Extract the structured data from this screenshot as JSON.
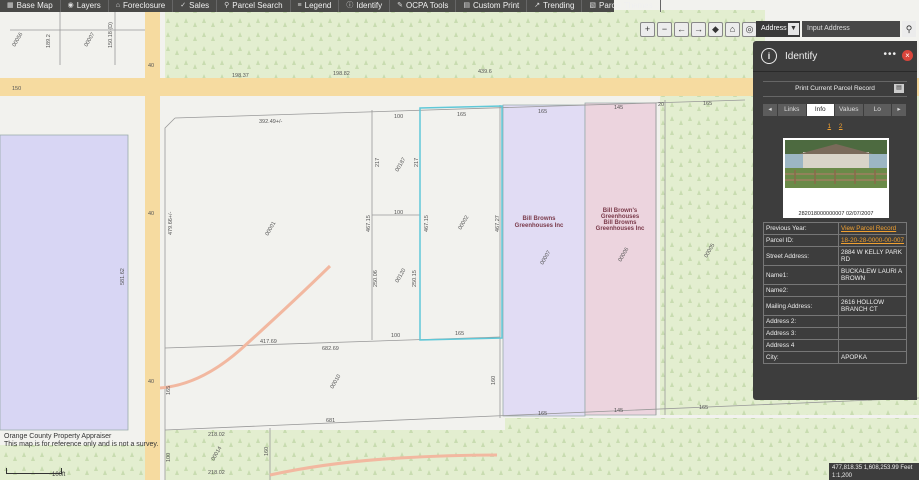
{
  "toolbar": {
    "items": [
      {
        "label": "Base Map",
        "icon": "map-icon"
      },
      {
        "label": "Layers",
        "icon": "eye-icon"
      },
      {
        "label": "Foreclosure",
        "icon": "home-icon"
      },
      {
        "label": "Sales",
        "icon": "check-icon"
      },
      {
        "label": "Parcel Search",
        "icon": "search-icon"
      },
      {
        "label": "Legend",
        "icon": "list-icon"
      },
      {
        "label": "Identify",
        "icon": "info-icon"
      },
      {
        "label": "OCPA Tools",
        "icon": "wrench-icon"
      },
      {
        "label": "Custom Print",
        "icon": "print-icon"
      },
      {
        "label": "Trending",
        "icon": "trend-icon"
      },
      {
        "label": "Parcel Themes",
        "icon": "theme-icon"
      }
    ]
  },
  "search": {
    "type_label": "Address",
    "placeholder": "Input Address"
  },
  "map": {
    "labels": {
      "parcel_00056": "00056",
      "d189_2": "189.2",
      "parcel_00007": "00007",
      "d150_18": "150.18 (D)",
      "d150": "150",
      "d40": "40",
      "d198_37": "198.37",
      "d198_82": "198.82",
      "d439_6": "439.6",
      "d392_49": "392.49+/-",
      "d100a": "100",
      "d165a": "165",
      "d165b": "165",
      "d145a": "145",
      "d20": "20",
      "d165c": "165",
      "d217a": "217",
      "d217b": "217",
      "parcel_00187": "00187",
      "d100b": "100",
      "parcel_00001": "00001",
      "d467_15a": "467.15",
      "d467_15b": "467.15",
      "parcel_00002": "00002",
      "d467_27": "467.27",
      "bb_label1": "Bill Browns Greenhouses Inc",
      "bb_label2": "Bill Brown's Greenhouses Bill Browns Greenhouses Inc",
      "parcel_00007b": "00007",
      "parcel_00006": "00006",
      "parcel_00005": "00005",
      "d479_66": "479.66+/-",
      "d40b": "40",
      "d250_06": "250.06",
      "parcel_00120": "00120",
      "d250_15": "250.15",
      "d100c": "100",
      "d165d": "165",
      "d417_69": "417.69",
      "d682_69": "682.69",
      "d581_62": "581.62",
      "d40c": "40",
      "d165e": "165",
      "parcel_00010": "00010",
      "d165f": "165",
      "d145b": "145",
      "d165g": "165",
      "d160": "160",
      "d681": "681",
      "d218_02a": "218.02",
      "d218_02b": "218.02",
      "parcel_00014": "00014",
      "d100d": "100",
      "d165h": "165",
      "d160b": "160"
    },
    "disclaimer_line1": "Orange County Property Appraiser",
    "disclaimer_line2": "This map is for reference only and is not a survey.",
    "scale_label": "100ft",
    "coords_line1": "477,818.35 1,608,253.99 Feet",
    "coords_line2": "1:1,200"
  },
  "identify": {
    "title": "Identify",
    "print_label": "Print Current Parcel Record",
    "tabs": [
      "Links",
      "Info",
      "Values",
      "Lo"
    ],
    "active_tab": "Info",
    "pages": [
      "1",
      "2"
    ],
    "photo_caption": "282018000000007  02/07/2007",
    "rows": [
      {
        "key": "Previous Year:",
        "value": "View Parcel Record",
        "link": true
      },
      {
        "key": "Parcel ID:",
        "value": "18-20-28-0000-00-007",
        "link": true
      },
      {
        "key": "Street Address:",
        "value": "2884 W KELLY PARK RD",
        "link": false
      },
      {
        "key": "Name1:",
        "value": "BUCKALEW LAURI A BROWN",
        "link": false
      },
      {
        "key": "Name2:",
        "value": "",
        "link": false
      },
      {
        "key": "Mailing Address:",
        "value": "2616 HOLLOW BRANCH CT",
        "link": false
      },
      {
        "key": "Address 2:",
        "value": "",
        "link": false
      },
      {
        "key": "Address 3:",
        "value": "",
        "link": false
      },
      {
        "key": "Address 4",
        "value": "",
        "link": false
      },
      {
        "key": "City:",
        "value": "APOPKA",
        "link": false
      }
    ]
  }
}
